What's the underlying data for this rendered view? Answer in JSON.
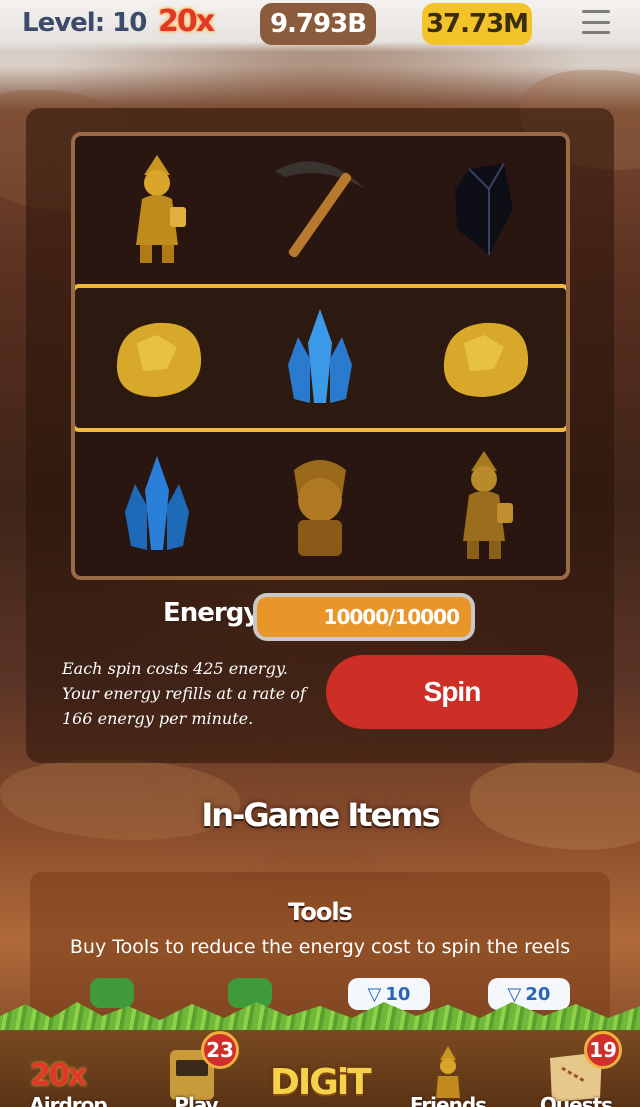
{
  "header": {
    "level": "Level: 10",
    "multiplier": "20x",
    "gold_balance": "9.793B",
    "points_balance": "37.73M",
    "menu_icon": "hamburger-menu-icon"
  },
  "slots": {
    "rows": [
      [
        "gnome-statue-icon",
        "pickaxe-icon",
        "obsidian-icon"
      ],
      [
        "gold-nugget-icon",
        "blue-crystal-icon",
        "gold-nugget-icon"
      ],
      [
        "blue-crystal-icon",
        "tiki-idol-icon",
        "gnome-statue-icon"
      ]
    ],
    "highlight_row": 1
  },
  "energy": {
    "label": "Energy",
    "value": "10000/10000",
    "fill_fraction": 1.0
  },
  "spin": {
    "info": "Each spin costs 425 energy. Your energy refills at a rate of 166 energy per minute.",
    "button_label": "Spin"
  },
  "items": {
    "title": "In-Game Items",
    "tools_title": "Tools",
    "tools_desc": "Buy Tools to reduce the energy cost to spin the reels",
    "costs": [
      "10",
      "20"
    ]
  },
  "nav": {
    "airdrop": "Airdrop",
    "airdrop_mult": "20x",
    "play": "Play",
    "play_badge": "23",
    "digit": "DIGiT",
    "friends": "Friends",
    "quests": "Quests",
    "quests_badge": "19"
  },
  "colors": {
    "accent_gold": "#f1b93a",
    "spin_red": "#cd2f26",
    "energy_orange": "#e8952a"
  }
}
